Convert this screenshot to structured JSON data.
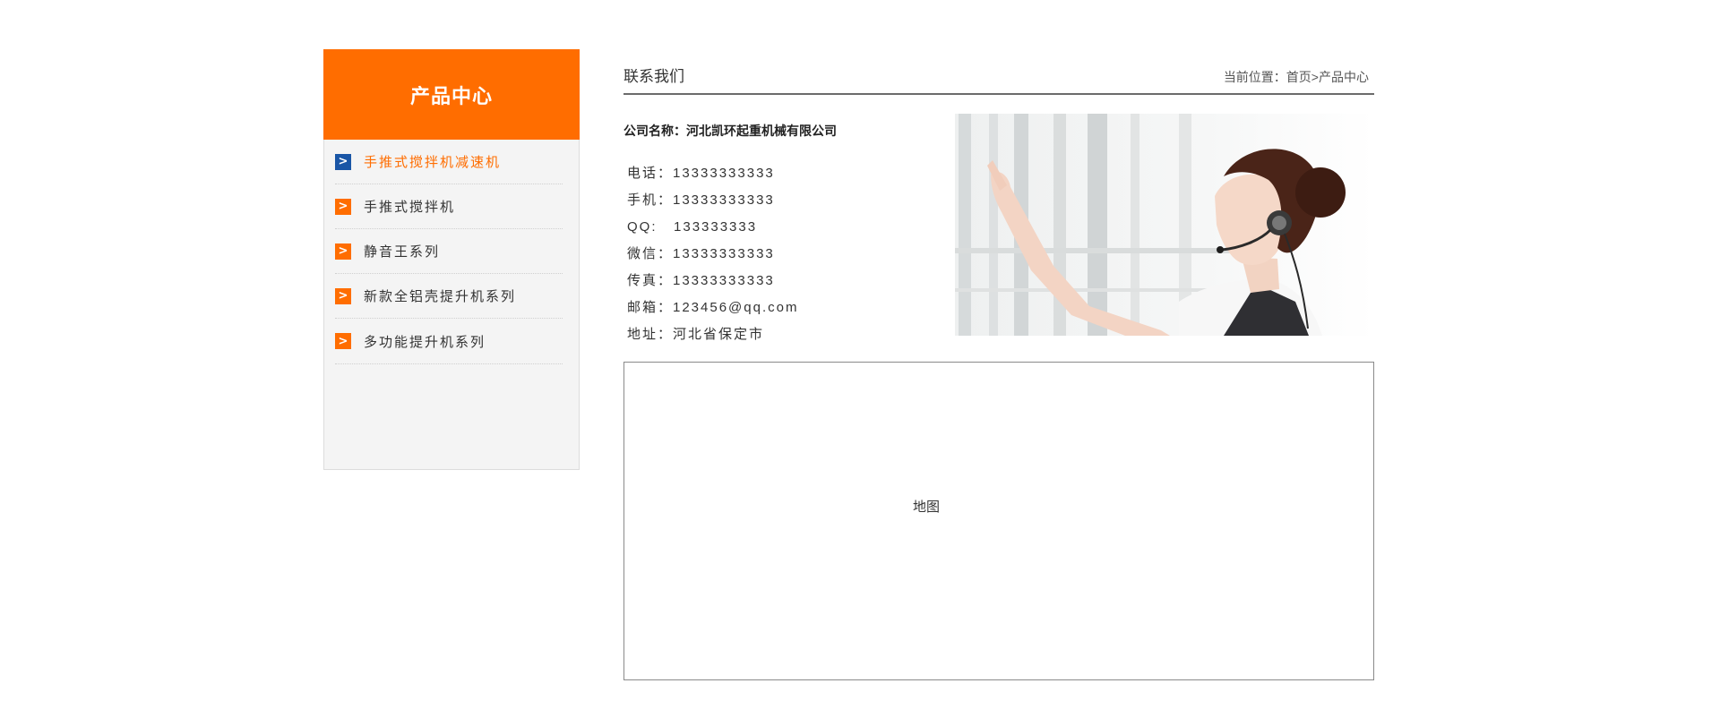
{
  "sidebar": {
    "title": "产品中心",
    "items": [
      {
        "label": "手推式搅拌机减速机",
        "active": true
      },
      {
        "label": "手推式搅拌机",
        "active": false
      },
      {
        "label": "静音王系列",
        "active": false
      },
      {
        "label": "新款全铝壳提升机系列",
        "active": false
      },
      {
        "label": "多功能提升机系列",
        "active": false
      }
    ],
    "arrow_glyph": ">"
  },
  "main": {
    "title": "联系我们",
    "breadcrumb": "当前位置：首页>产品中心",
    "company": "公司名称：河北凯环起重机械有限公司",
    "contacts": [
      "电话：13333333333",
      "手机：13333333333",
      "QQ:   133333333",
      "微信：13333333333",
      "传真：13333333333",
      "邮箱：123456@qq.com",
      "地址：河北省保定市"
    ],
    "map_label": "地图"
  },
  "colors": {
    "accent": "#ff6d00",
    "active_arrow": "#1a56a6"
  }
}
